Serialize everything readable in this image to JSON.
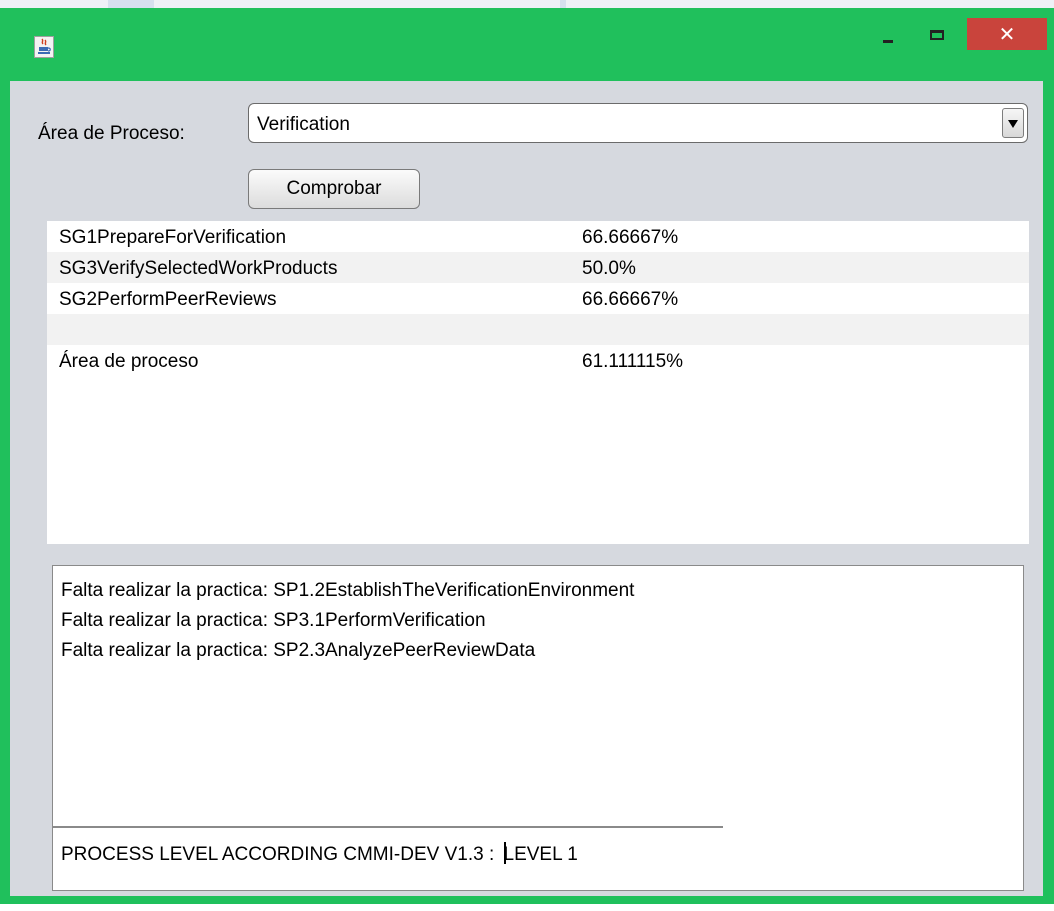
{
  "window": {
    "controls": {
      "close_glyph": "✕"
    }
  },
  "form": {
    "process_area_label": "Área de Proceso:",
    "process_area_value": "Verification",
    "check_button": "Comprobar"
  },
  "results": {
    "rows": [
      {
        "name": "SG1PrepareForVerification",
        "value": "66.66667%"
      },
      {
        "name": "SG3VerifySelectedWorkProducts",
        "value": "50.0%"
      },
      {
        "name": "SG2PerformPeerReviews",
        "value": "66.66667%"
      },
      {
        "name": "",
        "value": ""
      },
      {
        "name": "Área de proceso",
        "value": "61.111115%"
      }
    ]
  },
  "messages": {
    "lines": [
      "Falta realizar la practica: SP1.2EstablishTheVerificationEnvironment",
      "Falta realizar la practica: SP3.1PerformVerification",
      "Falta realizar la practica: SP2.3AnalyzePeerReviewData"
    ],
    "level_prefix": "PROCESS LEVEL ACCORDING CMMI-DEV V1.3 : ",
    "level_value": "LEVEL 1"
  },
  "colors": {
    "window_frame": "#20c05c",
    "close_button": "#c9443c",
    "client_background": "#d6d9df"
  },
  "icons": {
    "app": "java-cup-icon",
    "minimize": "minimize-icon",
    "maximize": "maximize-icon",
    "close": "close-icon",
    "dropdown": "chevron-down-icon"
  }
}
